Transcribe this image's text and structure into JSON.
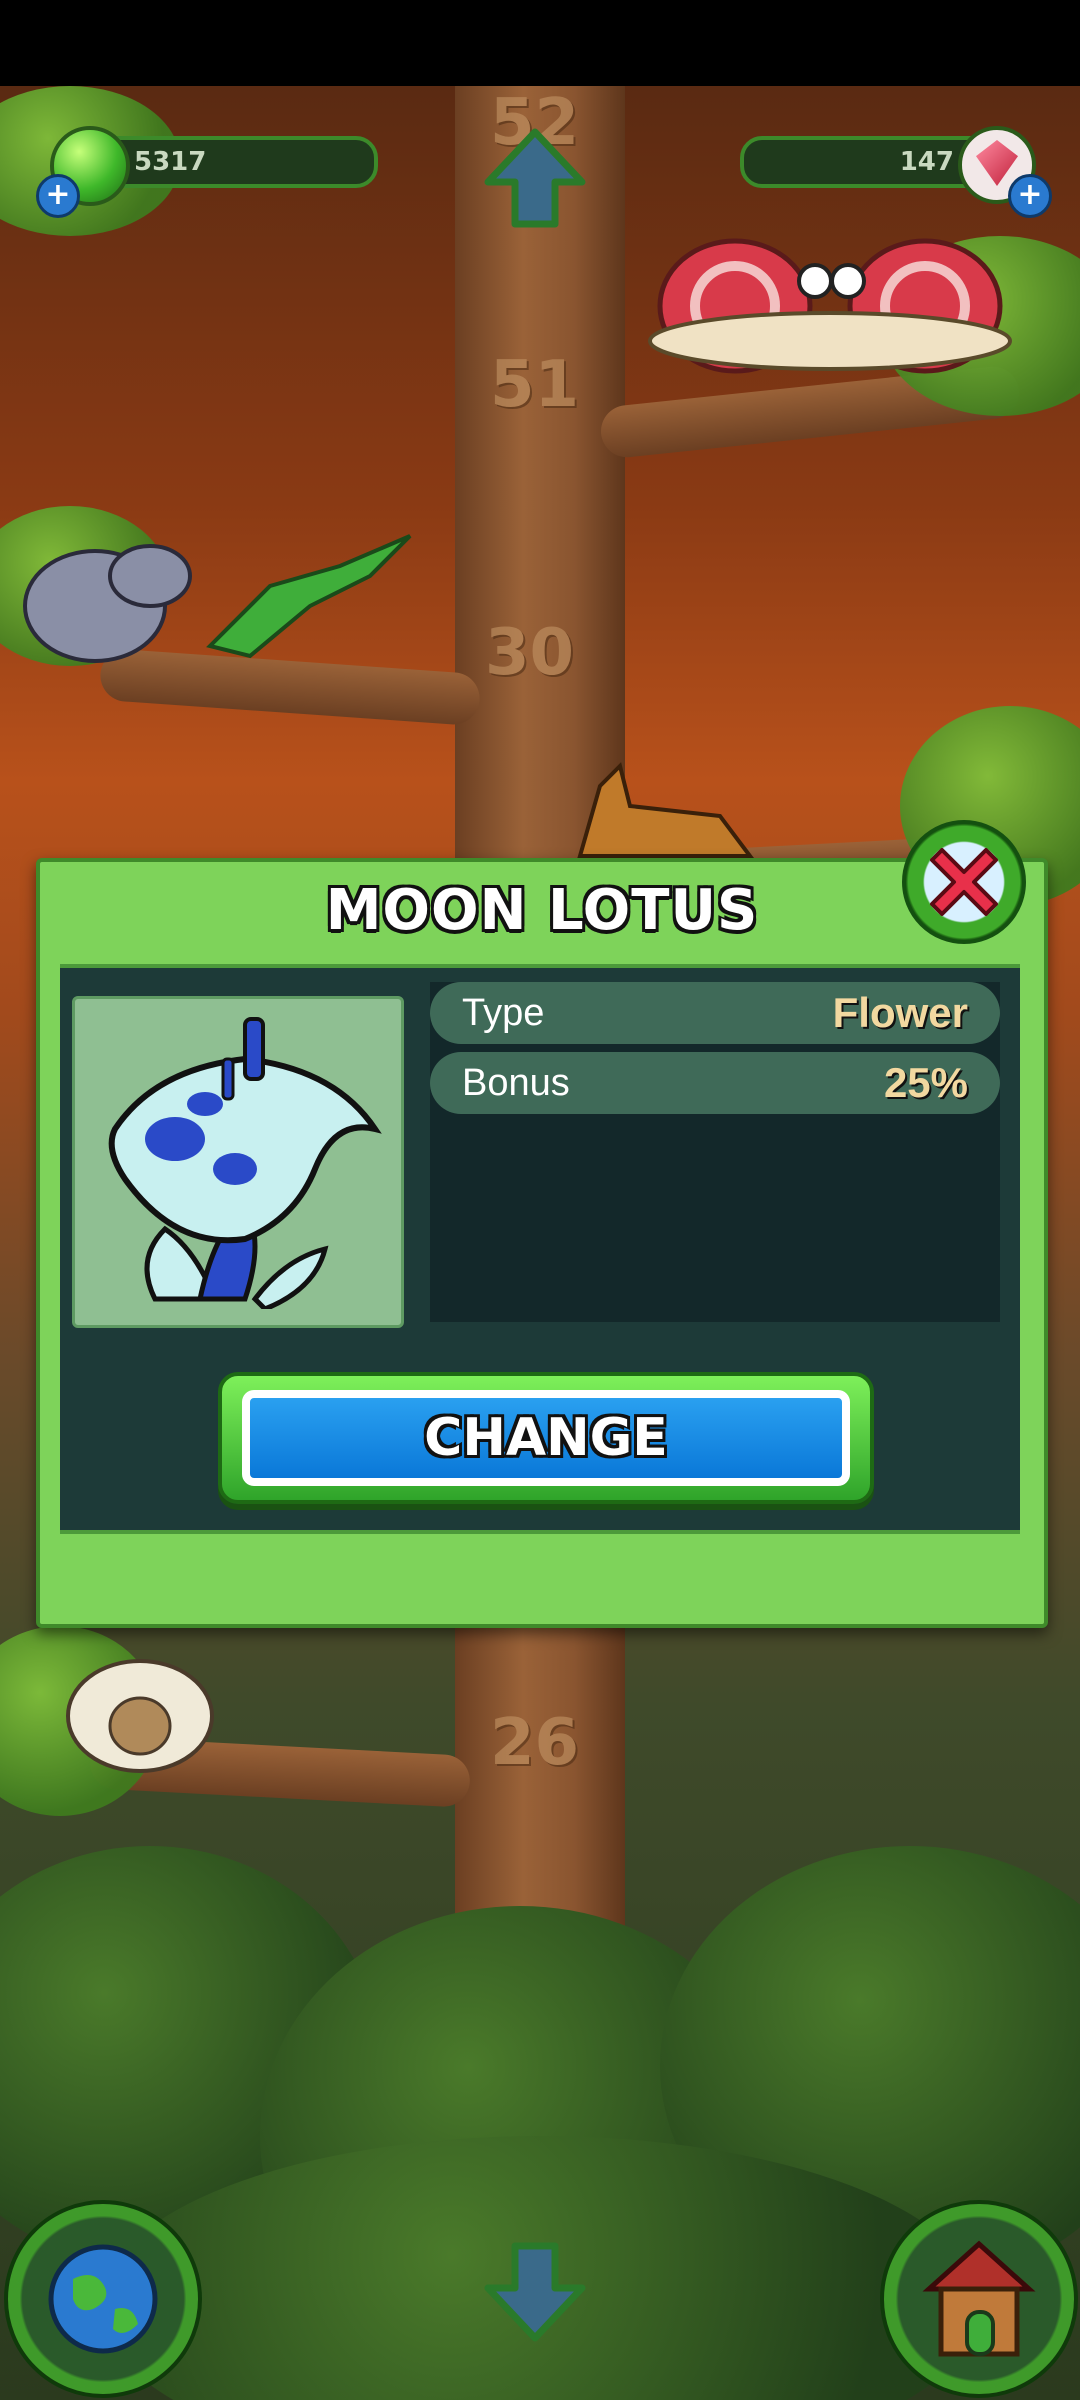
{
  "hud": {
    "coins": "5317",
    "gems": "147"
  },
  "tree": {
    "floor_numbers": [
      "52",
      "51",
      "30",
      "26"
    ]
  },
  "modal": {
    "title": "MOON LOTUS",
    "stats": [
      {
        "label": "Type",
        "value": "Flower"
      },
      {
        "label": "Bonus",
        "value": "25%"
      }
    ],
    "change_label": "CHANGE"
  },
  "icons": {
    "coin": "green-coin-icon",
    "gem": "red-gem-icon",
    "up": "up-arrow-icon",
    "down": "down-arrow-icon",
    "close": "close-x-icon",
    "globe": "globe-icon",
    "house": "house-icon",
    "item": "moon-lotus-flower-icon"
  },
  "colors": {
    "modal_green": "#7ed35a",
    "inner_panel": "#1d3a38",
    "change_blue": "#0a78d8",
    "close_red": "#e8304a"
  }
}
